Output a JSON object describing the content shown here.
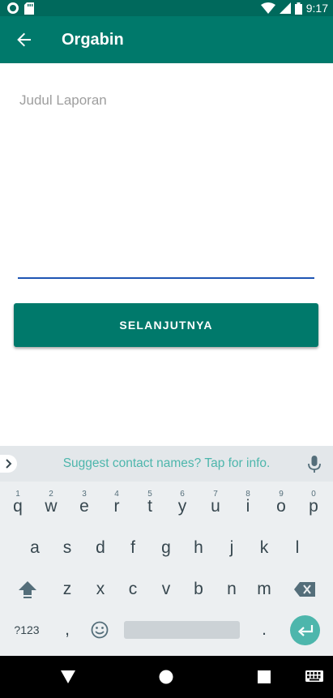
{
  "status_bar": {
    "time": "9:17",
    "icons": [
      "circle-notification-icon",
      "sd-card-icon",
      "wifi-icon",
      "cell-signal-icon",
      "battery-icon"
    ]
  },
  "app_bar": {
    "title": "Orgabin",
    "back_icon": "arrow-back-icon",
    "color": "#00796b"
  },
  "form": {
    "title_placeholder": "Judul Laporan",
    "title_value": "",
    "next_button_label": "SELANJUTNYA"
  },
  "keyboard": {
    "suggestion": "Suggest contact names? Tap for info.",
    "row1": [
      {
        "key": "q",
        "hint": "1"
      },
      {
        "key": "w",
        "hint": "2"
      },
      {
        "key": "e",
        "hint": "3"
      },
      {
        "key": "r",
        "hint": "4"
      },
      {
        "key": "t",
        "hint": "5"
      },
      {
        "key": "y",
        "hint": "6"
      },
      {
        "key": "u",
        "hint": "7"
      },
      {
        "key": "i",
        "hint": "8"
      },
      {
        "key": "o",
        "hint": "9"
      },
      {
        "key": "p",
        "hint": "0"
      }
    ],
    "row2": [
      "a",
      "s",
      "d",
      "f",
      "g",
      "h",
      "j",
      "k",
      "l"
    ],
    "row3": [
      "z",
      "x",
      "c",
      "v",
      "b",
      "n",
      "m"
    ],
    "symbols_label": "?123",
    "comma": ",",
    "period": ".",
    "accent_color": "#4db6ac"
  },
  "nav_bar": {
    "icons": [
      "back-triangle-icon",
      "home-circle-icon",
      "recents-square-icon",
      "keyboard-switch-icon"
    ]
  }
}
